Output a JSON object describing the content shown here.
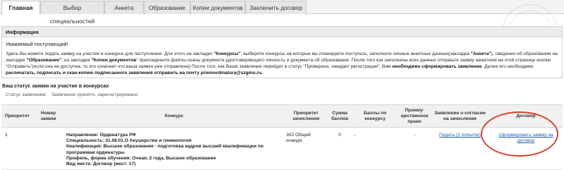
{
  "tabs": [
    {
      "label": "Главная",
      "active": true
    },
    {
      "label": "Выбор специальностей",
      "active": false
    },
    {
      "label": "Анкета",
      "active": false
    },
    {
      "label": "Образование",
      "active": false
    },
    {
      "label": "Копии документов",
      "active": false
    },
    {
      "label": "Заключить договор",
      "active": false
    }
  ],
  "info": {
    "title": "Информация",
    "greeting": "Уважаемый поступающий!",
    "p1": "Здесь Вы можете подать заявку на участие в конкурсе для поступления. Для этого на закладке ",
    "p1_b1": "\"Конкурсы\"",
    "p2": ", выберите конкурсы на которые вы планируете поступать, заполните личные анкетные данные(закладка ",
    "p2_b2": "\"Анкета\"",
    "p3": "), сведения об образовании на закладке ",
    "p3_b3": "\"Образование\"",
    "p4": ", на закладке ",
    "p4_b4": "\"Копии документов",
    "p5": "\" присоедините файлы-сканы документа удостоверяющего личность и документа об образовании. После того как заполнены всех данных отправьте заявку нажатием на этой странице кнопки \"Отправить\"(если она не доступна, то это означает что ваша заявка уже отправлена) После того, как Ваше заявление перейдет в статус \"Проверено, ожидает регистрации\", Вам ",
    "p5_b5": "необходимо сформировать заявление",
    "p6": ". Далее его необходимо ",
    "p6_b6": "распечатать, подписать и скан-копию подписанного заявления отправить на почту priemordinatura@szgmu.ru."
  },
  "status": {
    "title": "Ваш статус заявки на участие в конкурсах",
    "label": "Статус заявления:",
    "value": "Заявление принято, зарегистрировано"
  },
  "table": {
    "headers": {
      "priority": "Приоритет",
      "number": "Номер заявки",
      "competition": "Конкурс",
      "enroll_priority": "Приоритет зачисления",
      "score_sum": "Сумма баллов",
      "comp_score": "Баллы по конкурсу",
      "preemptive": "Преиму-щественное право",
      "consent": "Заявление о согласии на зачисление",
      "contract": "Договор"
    },
    "rows": [
      {
        "priority": "1",
        "number": "",
        "direction": "Направление: Ординатура РФ",
        "specialty": "Специальность: 31.08.01.О Акушерство и гинекология",
        "qualification": "Квалификация: Высшее образование - подготовка кадров высшей квалификации по программам ординатуры",
        "profile": "Профиль, форма обучения: Очная, 2 года, Высшее образование",
        "place": "Вид места: Договор (мест: 17)",
        "enroll_priority": "302 Общий конкурс",
        "score_sum": "0",
        "comp_score": "-",
        "preemptive": "-",
        "consent": "Подать (2 попытки)",
        "contract": "Сформировать заявку на договор"
      }
    ]
  },
  "accent": "#d3452c",
  "link_color": "#1a5fb4"
}
